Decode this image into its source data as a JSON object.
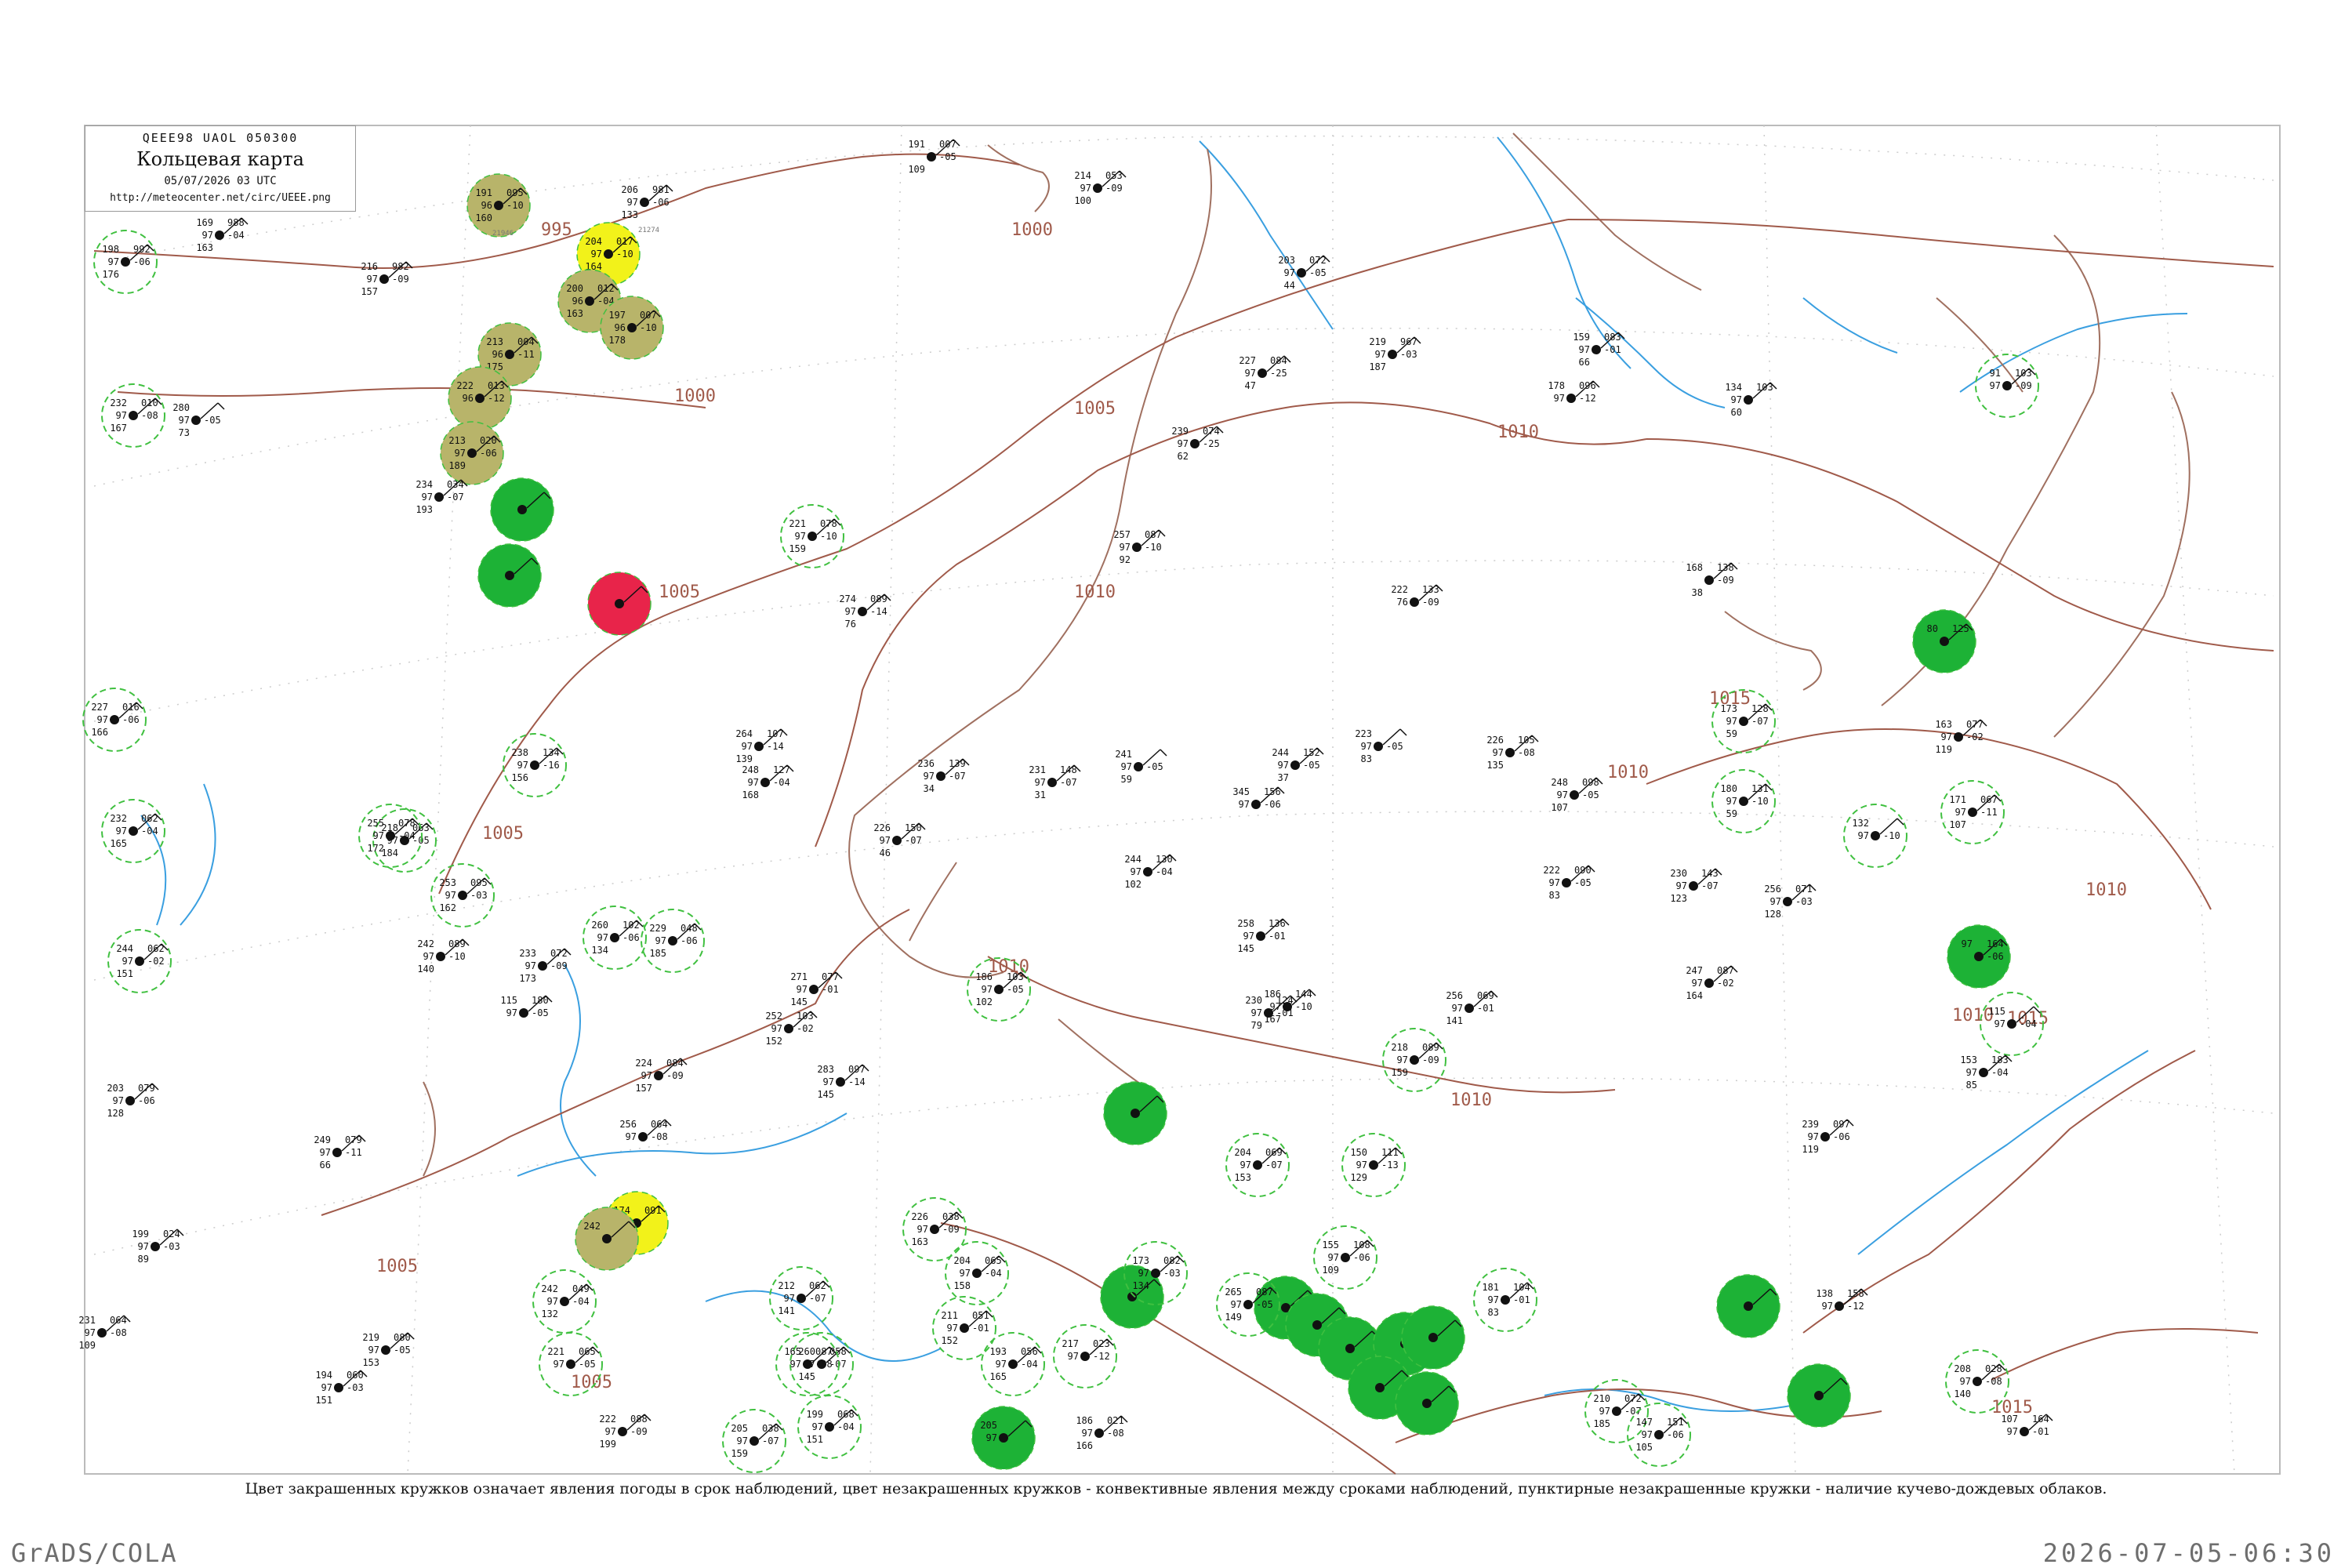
{
  "header": {
    "code_line": "QEEE98  UAOL  050300",
    "title": "Кольцевая карта",
    "datetime": "05/07/2026 03 UTC",
    "url": "http://meteocenter.net/circ/UEEE.png"
  },
  "isobar_labels": [
    "995",
    "1000",
    "1000",
    "1005",
    "1005",
    "1005",
    "1005",
    "1010",
    "1010",
    "1010",
    "1010",
    "1010",
    "1010",
    "1015",
    "1015",
    "1015",
    "1010",
    "1005"
  ],
  "stations": [
    {
      "n": "191",
      "p": "095",
      "t": "96",
      "v": "-10",
      "q": "160",
      "id": "21946",
      "s": "yellowgreen"
    },
    {
      "n": "206",
      "p": "981",
      "t": "97",
      "v": "-06",
      "q": "133",
      "id": "21274",
      "s": "none"
    },
    {
      "n": "204",
      "p": "017",
      "t": "97",
      "v": "-10",
      "q": "164",
      "id": "",
      "s": "yellow"
    },
    {
      "n": "200",
      "p": "012",
      "t": "96",
      "v": "-04",
      "q": "163",
      "id": "",
      "s": "yellowgreen"
    },
    {
      "n": "197",
      "p": "007",
      "t": "96",
      "v": "-10",
      "q": "178",
      "id": "",
      "s": "yellowgreen"
    },
    {
      "n": "213",
      "p": "004",
      "t": "96",
      "v": "-11",
      "q": "175",
      "id": "",
      "s": "yellowgreen"
    },
    {
      "n": "222",
      "p": "013",
      "t": "96",
      "v": "-12",
      "q": "",
      "id": "",
      "s": "yellowgreen"
    },
    {
      "n": "213",
      "p": "020",
      "t": "97",
      "v": "-06",
      "q": "189",
      "id": "",
      "s": "yellowgreen"
    },
    {
      "n": "234",
      "p": "034",
      "t": "97",
      "v": "-07",
      "q": "193",
      "id": "",
      "s": "none"
    },
    {
      "n": "",
      "p": "",
      "t": "",
      "v": "",
      "q": "",
      "id": "",
      "s": "green"
    },
    {
      "n": "",
      "p": "",
      "t": "",
      "v": "",
      "q": "",
      "id": "",
      "s": "green"
    },
    {
      "n": "",
      "p": "",
      "t": "",
      "v": "",
      "q": "",
      "id": "",
      "s": "red"
    },
    {
      "n": "174",
      "p": "091",
      "t": "",
      "v": "",
      "q": "",
      "id": "",
      "s": "yellow"
    },
    {
      "n": "242",
      "p": "",
      "t": "",
      "v": "",
      "q": "",
      "id": "",
      "s": "yellowgreen"
    },
    {
      "n": "169",
      "p": "988",
      "t": "97",
      "v": "-04",
      "q": "163",
      "id": "",
      "s": "none"
    },
    {
      "n": "198",
      "p": "992",
      "t": "97",
      "v": "-06",
      "q": "176",
      "id": "",
      "s": "dashed"
    },
    {
      "n": "216",
      "p": "982",
      "t": "97",
      "v": "-09",
      "q": "157",
      "id": "",
      "s": "none"
    },
    {
      "n": "214",
      "p": "053",
      "t": "97",
      "v": "-09",
      "q": "100",
      "id": "",
      "s": "none"
    },
    {
      "n": "191",
      "p": "007",
      "t": "",
      "v": "-05",
      "q": "109",
      "id": "",
      "s": "none"
    },
    {
      "n": "203",
      "p": "072",
      "t": "97",
      "v": "-05",
      "q": "44",
      "id": "",
      "s": "none"
    },
    {
      "n": "227",
      "p": "084",
      "t": "97",
      "v": "-25",
      "q": "47",
      "id": "",
      "s": "none"
    },
    {
      "n": "219",
      "p": "967",
      "t": "97",
      "v": "-03",
      "q": "187",
      "id": "",
      "s": "none"
    },
    {
      "n": "239",
      "p": "074",
      "t": "97",
      "v": "-25",
      "q": "62",
      "id": "",
      "s": "none"
    },
    {
      "n": "257",
      "p": "087",
      "t": "97",
      "v": "-10",
      "q": "92",
      "id": "",
      "s": "none"
    },
    {
      "n": "274",
      "p": "089",
      "t": "97",
      "v": "-14",
      "q": "76",
      "id": "",
      "s": "none"
    },
    {
      "n": "159",
      "p": "083",
      "t": "97",
      "v": "-01",
      "q": "66",
      "id": "",
      "s": "none"
    },
    {
      "n": "178",
      "p": "096",
      "t": "97",
      "v": "-12",
      "q": "",
      "id": "",
      "s": "none"
    },
    {
      "n": "134",
      "p": "103",
      "t": "97",
      "v": "",
      "q": "60",
      "id": "",
      "s": "none"
    },
    {
      "n": "91",
      "p": "103",
      "t": "97",
      "v": "-09",
      "q": "",
      "id": "",
      "s": "dashed"
    },
    {
      "n": "168",
      "p": "138",
      "t": "",
      "v": "-09",
      "q": "38",
      "id": "",
      "s": "none"
    },
    {
      "n": "222",
      "p": "133",
      "t": "76",
      "v": "-09",
      "q": "",
      "id": "",
      "s": "none"
    },
    {
      "n": "80",
      "p": "125",
      "t": "",
      "v": "",
      "q": "",
      "id": "",
      "s": "green"
    },
    {
      "n": "163",
      "p": "077",
      "t": "97",
      "v": "-02",
      "q": "119",
      "id": "",
      "s": "none"
    },
    {
      "n": "171",
      "p": "067",
      "t": "97",
      "v": "-11",
      "q": "107",
      "id": "",
      "s": "dashed"
    },
    {
      "n": "173",
      "p": "128",
      "t": "97",
      "v": "-07",
      "q": "59",
      "id": "",
      "s": "dashed"
    },
    {
      "n": "180",
      "p": "131",
      "t": "97",
      "v": "-10",
      "q": "59",
      "id": "",
      "s": "dashed"
    },
    {
      "n": "132",
      "p": "",
      "t": "97",
      "v": "-10",
      "q": "",
      "id": "",
      "s": "dashed"
    },
    {
      "n": "256",
      "p": "071",
      "t": "97",
      "v": "-03",
      "q": "128",
      "id": "",
      "s": "none"
    },
    {
      "n": "97",
      "p": "164",
      "t": "",
      "v": "-06",
      "q": "",
      "id": "",
      "s": "green"
    },
    {
      "n": "115",
      "p": "",
      "t": "97",
      "v": "-04",
      "q": "",
      "id": "",
      "s": "dashed"
    },
    {
      "n": "153",
      "p": "183",
      "t": "97",
      "v": "-04",
      "q": "85",
      "id": "",
      "s": "none"
    },
    {
      "n": "",
      "p": "",
      "t": "",
      "v": "",
      "q": "",
      "id": "",
      "s": "green"
    },
    {
      "n": "",
      "p": "",
      "t": "",
      "v": "",
      "q": "",
      "id": "",
      "s": "green"
    },
    {
      "n": "",
      "p": "",
      "t": "",
      "v": "",
      "q": "",
      "id": "",
      "s": "green"
    },
    {
      "n": "",
      "p": "",
      "t": "",
      "v": "",
      "q": "",
      "id": "",
      "s": "green"
    },
    {
      "n": "",
      "p": "",
      "t": "",
      "v": "",
      "q": "",
      "id": "",
      "s": "green"
    },
    {
      "n": "",
      "p": "",
      "t": "",
      "v": "",
      "q": "",
      "id": "",
      "s": "green"
    },
    {
      "n": "",
      "p": "",
      "t": "",
      "v": "",
      "q": "",
      "id": "",
      "s": "green"
    },
    {
      "n": "",
      "p": "",
      "t": "",
      "v": "",
      "q": "",
      "id": "",
      "s": "green"
    },
    {
      "n": "",
      "p": "",
      "t": "",
      "v": "",
      "q": "",
      "id": "",
      "s": "green"
    },
    {
      "n": "",
      "p": "",
      "t": "",
      "v": "",
      "q": "",
      "id": "",
      "s": "green"
    },
    {
      "n": "",
      "p": "",
      "t": "",
      "v": "",
      "q": "",
      "id": "",
      "s": "green"
    },
    {
      "n": "260",
      "p": "058",
      "t": "97",
      "v": "-07",
      "q": "145",
      "id": "",
      "s": "dashed"
    },
    {
      "n": "221",
      "p": "078",
      "t": "97",
      "v": "-10",
      "q": "159",
      "id": "",
      "s": "dashed"
    },
    {
      "n": "238",
      "p": "134",
      "t": "97",
      "v": "-16",
      "q": "156",
      "id": "",
      "s": "dashed"
    },
    {
      "n": "186",
      "p": "103",
      "t": "97",
      "v": "-05",
      "q": "102",
      "id": "",
      "s": "dashed"
    },
    {
      "n": "218",
      "p": "089",
      "t": "97",
      "v": "-09",
      "q": "159",
      "id": "",
      "s": "dashed"
    },
    {
      "n": "204",
      "p": "069",
      "t": "97",
      "v": "-07",
      "q": "153",
      "id": "",
      "s": "dashed"
    },
    {
      "n": "150",
      "p": "111",
      "t": "97",
      "v": "-13",
      "q": "129",
      "id": "",
      "s": "dashed"
    },
    {
      "n": "155",
      "p": "108",
      "t": "97",
      "v": "-06",
      "q": "109",
      "id": "",
      "s": "dashed"
    },
    {
      "n": "181",
      "p": "104",
      "t": "97",
      "v": "-01",
      "q": "83",
      "id": "",
      "s": "dashed"
    },
    {
      "n": "210",
      "p": "072",
      "t": "97",
      "v": "-07",
      "q": "185",
      "id": "",
      "s": "dashed"
    },
    {
      "n": "147",
      "p": "151",
      "t": "97",
      "v": "-06",
      "q": "105",
      "id": "",
      "s": "dashed"
    },
    {
      "n": "107",
      "p": "164",
      "t": "97",
      "v": "-01",
      "q": "",
      "id": "",
      "s": "none"
    },
    {
      "n": "138",
      "p": "158",
      "t": "97",
      "v": "-12",
      "q": "",
      "id": "",
      "s": "none"
    },
    {
      "n": "208",
      "p": "028",
      "t": "97",
      "v": "-08",
      "q": "140",
      "id": "",
      "s": "dashed"
    },
    {
      "n": "205",
      "p": "038",
      "t": "97",
      "v": "-07",
      "q": "159",
      "id": "",
      "s": "dashed"
    },
    {
      "n": "199",
      "p": "068",
      "t": "97",
      "v": "-04",
      "q": "151",
      "id": "",
      "s": "dashed"
    },
    {
      "n": "212",
      "p": "062",
      "t": "97",
      "v": "-07",
      "q": "141",
      "id": "",
      "s": "dashed"
    },
    {
      "n": "226",
      "p": "038",
      "t": "97",
      "v": "-09",
      "q": "163",
      "id": "",
      "s": "dashed"
    },
    {
      "n": "211",
      "p": "051",
      "t": "97",
      "v": "-01",
      "q": "152",
      "id": "",
      "s": "dashed"
    },
    {
      "n": "204",
      "p": "065",
      "t": "97",
      "v": "-04",
      "q": "158",
      "id": "",
      "s": "dashed"
    },
    {
      "n": "193",
      "p": "056",
      "t": "97",
      "v": "-04",
      "q": "165",
      "id": "",
      "s": "dashed"
    },
    {
      "n": "217",
      "p": "023",
      "t": "97",
      "v": "-12",
      "q": "",
      "id": "",
      "s": "dashed"
    },
    {
      "n": "186",
      "p": "021",
      "t": "97",
      "v": "-08",
      "q": "166",
      "id": "",
      "s": "none"
    },
    {
      "n": "205",
      "p": "",
      "t": "97",
      "v": "",
      "q": "",
      "id": "",
      "s": "green"
    },
    {
      "n": "165",
      "p": "087",
      "t": "97",
      "v": "-08",
      "q": "",
      "id": "",
      "s": "dashed"
    },
    {
      "n": "173",
      "p": "082",
      "t": "97",
      "v": "-03",
      "q": "134",
      "id": "",
      "s": "dashed"
    },
    {
      "n": "265",
      "p": "087",
      "t": "97",
      "v": "-05",
      "q": "149",
      "id": "",
      "s": "dashed"
    },
    {
      "n": "242",
      "p": "049",
      "t": "97",
      "v": "-04",
      "q": "132",
      "id": "",
      "s": "dashed"
    },
    {
      "n": "221",
      "p": "065",
      "t": "97",
      "v": "-05",
      "q": "",
      "id": "",
      "s": "dashed"
    },
    {
      "n": "232",
      "p": "062",
      "t": "97",
      "v": "-04",
      "q": "165",
      "id": "",
      "s": "dashed"
    },
    {
      "n": "218",
      "p": "063",
      "t": "97",
      "v": "-05",
      "q": "184",
      "id": "",
      "s": "dashed"
    },
    {
      "n": "255",
      "p": "078",
      "t": "97",
      "v": "-04",
      "q": "172",
      "id": "",
      "s": "dashed"
    },
    {
      "n": "253",
      "p": "095",
      "t": "97",
      "v": "-03",
      "q": "162",
      "id": "",
      "s": "dashed"
    },
    {
      "n": "260",
      "p": "102",
      "t": "97",
      "v": "-06",
      "q": "134",
      "id": "",
      "s": "dashed"
    },
    {
      "n": "229",
      "p": "048",
      "t": "97",
      "v": "-06",
      "q": "185",
      "id": "",
      "s": "dashed"
    },
    {
      "n": "244",
      "p": "062",
      "t": "97",
      "v": "-02",
      "q": "151",
      "id": "",
      "s": "dashed"
    },
    {
      "n": "227",
      "p": "016",
      "t": "97",
      "v": "-06",
      "q": "166",
      "id": "",
      "s": "dashed"
    },
    {
      "n": "232",
      "p": "010",
      "t": "97",
      "v": "-08",
      "q": "167",
      "id": "",
      "s": "dashed"
    },
    {
      "n": "280",
      "p": "",
      "t": "97",
      "v": "-05",
      "q": "73",
      "id": "",
      "s": "none"
    },
    {
      "n": "203",
      "p": "079",
      "t": "97",
      "v": "-06",
      "q": "128",
      "id": "",
      "s": "none"
    },
    {
      "n": "249",
      "p": "079",
      "t": "97",
      "v": "-11",
      "q": "66",
      "id": "",
      "s": "none"
    },
    {
      "n": "199",
      "p": "024",
      "t": "97",
      "v": "-03",
      "q": "89",
      "id": "",
      "s": "none"
    },
    {
      "n": "231",
      "p": "064",
      "t": "97",
      "v": "-08",
      "q": "109",
      "id": "",
      "s": "none"
    },
    {
      "n": "219",
      "p": "080",
      "t": "97",
      "v": "-05",
      "q": "153",
      "id": "",
      "s": "none"
    },
    {
      "n": "194",
      "p": "060",
      "t": "97",
      "v": "-03",
      "q": "151",
      "id": "",
      "s": "none"
    },
    {
      "n": "222",
      "p": "088",
      "t": "97",
      "v": "-09",
      "q": "199",
      "id": "",
      "s": "none"
    },
    {
      "n": "224",
      "p": "084",
      "t": "97",
      "v": "-09",
      "q": "157",
      "id": "",
      "s": "none"
    },
    {
      "n": "256",
      "p": "064",
      "t": "97",
      "v": "-08",
      "q": "",
      "id": "",
      "s": "none"
    },
    {
      "n": "283",
      "p": "097",
      "t": "97",
      "v": "-14",
      "q": "145",
      "id": "",
      "s": "none"
    },
    {
      "n": "264",
      "p": "107",
      "t": "97",
      "v": "-14",
      "q": "139",
      "id": "",
      "s": "none"
    },
    {
      "n": "248",
      "p": "127",
      "t": "97",
      "v": "-04",
      "q": "168",
      "id": "",
      "s": "none"
    },
    {
      "n": "236",
      "p": "139",
      "t": "97",
      "v": "-07",
      "q": "34",
      "id": "",
      "s": "none"
    },
    {
      "n": "231",
      "p": "148",
      "t": "97",
      "v": "-07",
      "q": "31",
      "id": "",
      "s": "none"
    },
    {
      "n": "241",
      "p": "",
      "t": "97",
      "v": "-05",
      "q": "59",
      "id": "",
      "s": "none"
    },
    {
      "n": "345",
      "p": "156",
      "t": "97",
      "v": "-06",
      "q": "",
      "id": "",
      "s": "none"
    },
    {
      "n": "244",
      "p": "152",
      "t": "97",
      "v": "-05",
      "q": "37",
      "id": "",
      "s": "none"
    },
    {
      "n": "223",
      "p": "",
      "t": "97",
      "v": "-05",
      "q": "83",
      "id": "",
      "s": "none"
    },
    {
      "n": "226",
      "p": "105",
      "t": "97",
      "v": "-08",
      "q": "135",
      "id": "",
      "s": "none"
    },
    {
      "n": "248",
      "p": "098",
      "t": "97",
      "v": "-05",
      "q": "107",
      "id": "",
      "s": "none"
    },
    {
      "n": "222",
      "p": "090",
      "t": "97",
      "v": "-05",
      "q": "83",
      "id": "",
      "s": "none"
    },
    {
      "n": "230",
      "p": "143",
      "t": "97",
      "v": "-07",
      "q": "123",
      "id": "",
      "s": "none"
    },
    {
      "n": "244",
      "p": "130",
      "t": "97",
      "v": "-04",
      "q": "102",
      "id": "",
      "s": "none"
    },
    {
      "n": "226",
      "p": "150",
      "t": "97",
      "v": "-07",
      "q": "46",
      "id": "",
      "s": "none"
    },
    {
      "n": "258",
      "p": "136",
      "t": "97",
      "v": "-01",
      "q": "145",
      "id": "",
      "s": "none"
    },
    {
      "n": "186",
      "p": "144",
      "t": "97",
      "v": "-10",
      "q": "167",
      "id": "",
      "s": "none"
    },
    {
      "n": "230",
      "p": "124",
      "t": "97",
      "v": "-01",
      "q": "79",
      "id": "",
      "s": "none"
    },
    {
      "n": "256",
      "p": "069",
      "t": "97",
      "v": "-01",
      "q": "141",
      "id": "",
      "s": "none"
    },
    {
      "n": "247",
      "p": "087",
      "t": "97",
      "v": "-02",
      "q": "164",
      "id": "",
      "s": "none"
    },
    {
      "n": "252",
      "p": "103",
      "t": "97",
      "v": "-02",
      "q": "152",
      "id": "",
      "s": "none"
    },
    {
      "n": "271",
      "p": "077",
      "t": "97",
      "v": "-01",
      "q": "145",
      "id": "",
      "s": "none"
    },
    {
      "n": "233",
      "p": "072",
      "t": "97",
      "v": "-09",
      "q": "173",
      "id": "",
      "s": "none"
    },
    {
      "n": "242",
      "p": "089",
      "t": "97",
      "v": "-10",
      "q": "140",
      "id": "",
      "s": "none"
    },
    {
      "n": "115",
      "p": "180",
      "t": "97",
      "v": "-05",
      "q": "",
      "id": "",
      "s": "none"
    },
    {
      "n": "239",
      "p": "097",
      "t": "97",
      "v": "-06",
      "q": "119",
      "id": "",
      "s": "none"
    }
  ],
  "caption": "Цвет закрашенных кружков означает явления погоды в срок наблюдений, цвет незакрашенных кружков - конвективные явления между сроками наблюдений, пунктирные незакрашенные кружки - наличие кучево-дождевых облаков.",
  "footer": {
    "left": "GrADS/COLA",
    "right": "2026-07-05-06:30"
  },
  "colors": {
    "isobar": "#a05a4a",
    "river": "#3a9fe0",
    "frame": "#bbbbbb",
    "green_fill": "#1db236",
    "yellowgreen_fill": "#b8b46a",
    "yellow_fill": "#f2f21a",
    "red_fill": "#e8244a",
    "dashed_ring": "#40c040"
  }
}
